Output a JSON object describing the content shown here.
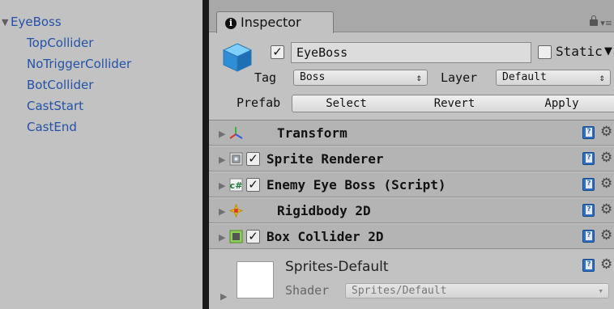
{
  "hierarchy": {
    "root": "EyeBoss",
    "children": [
      "TopCollider",
      "NoTriggerCollider",
      "BotCollider",
      "CastStart",
      "CastEnd"
    ]
  },
  "inspector": {
    "tab_label": "Inspector",
    "object_name": "EyeBoss",
    "active": true,
    "static_label": "Static",
    "static_checked": false,
    "tag_label": "Tag",
    "tag_value": "Boss",
    "layer_label": "Layer",
    "layer_value": "Default",
    "prefab_label": "Prefab",
    "prefab_buttons": [
      "Select",
      "Revert",
      "Apply"
    ],
    "components": [
      {
        "name": "Transform",
        "icon": "transform-icon",
        "checkbox": false
      },
      {
        "name": "Sprite Renderer",
        "icon": "sprite-renderer-icon",
        "checkbox": true
      },
      {
        "name": "Enemy Eye Boss (Script)",
        "icon": "script-icon",
        "checkbox": true
      },
      {
        "name": "Rigidbody 2D",
        "icon": "rigidbody-icon",
        "checkbox": false
      },
      {
        "name": "Box Collider 2D",
        "icon": "box-collider-icon",
        "checkbox": true
      }
    ],
    "material": {
      "name": "Sprites-Default",
      "shader_label": "Shader",
      "shader_value": "Sprites/Default"
    }
  },
  "colors": {
    "panel_bg": "#c2c2c2",
    "component_header_bg": "#b4b4b4",
    "hierarchy_text": "#2452a8",
    "divider": "#1a1a1a"
  }
}
